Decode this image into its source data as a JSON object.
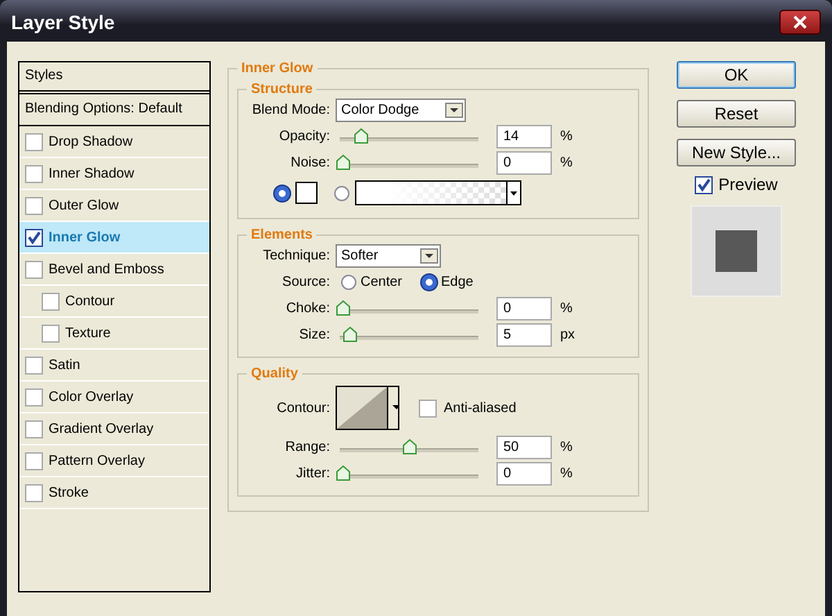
{
  "window": {
    "title": "Layer Style"
  },
  "styles_panel": {
    "header": "Styles",
    "blending": "Blending Options: Default",
    "items": [
      {
        "label": "Drop Shadow",
        "checked": false,
        "selected": false
      },
      {
        "label": "Inner Shadow",
        "checked": false,
        "selected": false
      },
      {
        "label": "Outer Glow",
        "checked": false,
        "selected": false
      },
      {
        "label": "Inner Glow",
        "checked": true,
        "selected": true
      },
      {
        "label": "Bevel and Emboss",
        "checked": false,
        "selected": false,
        "children": [
          {
            "label": "Contour",
            "checked": false,
            "selected": false
          },
          {
            "label": "Texture",
            "checked": false,
            "selected": false
          }
        ]
      },
      {
        "label": "Satin",
        "checked": false,
        "selected": false
      },
      {
        "label": "Color Overlay",
        "checked": false,
        "selected": false
      },
      {
        "label": "Gradient Overlay",
        "checked": false,
        "selected": false
      },
      {
        "label": "Pattern Overlay",
        "checked": false,
        "selected": false
      },
      {
        "label": "Stroke",
        "checked": false,
        "selected": false
      }
    ]
  },
  "inner_glow": {
    "title": "Inner Glow",
    "structure": {
      "title": "Structure",
      "blend_mode": {
        "label": "Blend Mode:",
        "value": "Color Dodge"
      },
      "sliders": [
        {
          "label": "Opacity:",
          "level": 0.14,
          "value": "14",
          "unit": "%"
        },
        {
          "label": "Noise:",
          "level": 0,
          "value": "0",
          "unit": "%"
        }
      ],
      "fill": [
        {
          "kind": "color",
          "selected": true
        },
        {
          "kind": "gradient",
          "selected": false
        }
      ]
    },
    "elements": {
      "title": "Elements",
      "technique": {
        "label": "Technique:",
        "value": "Softer"
      },
      "source": {
        "label": "Source:",
        "options": [
          {
            "label": "Center",
            "selected": false
          },
          {
            "label": "Edge",
            "selected": true
          }
        ]
      },
      "sliders": [
        {
          "label": "Choke:",
          "level": 0,
          "value": "0",
          "unit": "%"
        },
        {
          "label": "Size:",
          "level": 0.05,
          "value": "5",
          "unit": "px"
        }
      ]
    },
    "quality": {
      "title": "Quality",
      "contour": {
        "label": "Contour:"
      },
      "anti_aliased": {
        "label": "Anti-aliased",
        "checked": false
      },
      "sliders": [
        {
          "label": "Range:",
          "level": 0.5,
          "value": "50",
          "unit": "%"
        },
        {
          "label": "Jitter:",
          "level": 0,
          "value": "0",
          "unit": "%"
        }
      ]
    }
  },
  "buttons": [
    {
      "label": "OK",
      "default": true
    },
    {
      "label": "Reset",
      "default": false
    },
    {
      "label": "New Style...",
      "default": false
    }
  ],
  "preview": {
    "label": "Preview",
    "checked": true
  }
}
